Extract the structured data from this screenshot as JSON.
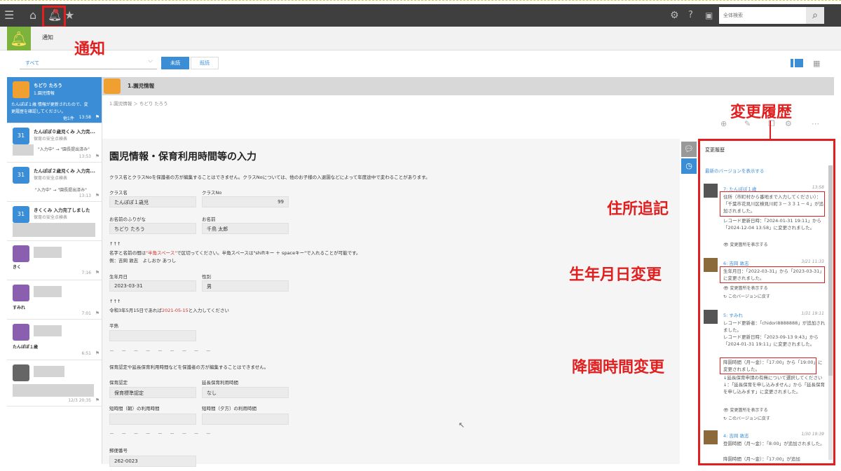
{
  "search": {
    "placeholder": "全体検索"
  },
  "header": {
    "title": "通知"
  },
  "filter": {
    "selected": "すべて",
    "tab_unread": "未読",
    "tab_read": "既読"
  },
  "left_list": [
    {
      "title": "ちどり たろう",
      "sub": "1.園児情報",
      "line1": "たんぽぽ１歳 情報が更新されたので、変",
      "line2": "更履歴を確認してください。",
      "count": "他1件",
      "time": "13:58"
    },
    {
      "title": "たんぽぽ０歳児くみ 入力完...",
      "sub": "保育の安全点検表",
      "line1": "\"入力中\" → \"園長提出済み\"",
      "time": "13:53"
    },
    {
      "title": "たんぽぽ２歳児くみ 入力完...",
      "sub": "保育の安全点検表",
      "line1": "\"入力中\" → \"園長提出済み\"",
      "time": "13:13"
    },
    {
      "title": "きくくみ 入力完了しました",
      "sub": "保育の安全点検表"
    },
    {
      "label": "きく",
      "time": "7:16"
    },
    {
      "label": "すみれ",
      "time": "7:01"
    },
    {
      "label": "たんぽぽ１歳",
      "time": "6:51"
    },
    {
      "time": "12/3 20:35"
    }
  ],
  "main": {
    "title": "1.園児情報",
    "breadcrumb": "1.園児情報 ＞ ちどり たろう",
    "form_title": "園児情報・保育利用時間等の入力",
    "desc": "クラス名とクラスNoを保護者の方が編集することはできません。クラスNoについては、他のお子様の入退園などによって年度途中で変わることがあります。",
    "class_name_label": "クラス名",
    "class_name": "たんぽぽ１歳児",
    "class_no_label": "クラスNo",
    "class_no": "99",
    "kana_label": "お名前のふりがな",
    "kana": "ちどり たろう",
    "name_label": "お名前",
    "name": "千鳥 太郎",
    "arrows1": "↑↑↑",
    "note1_a": "名字と名前の間は",
    "note1_red": "\"半角スペース\"",
    "note1_b": "で区切ってください。半角スペースは\"shiftキー ＋ spaceキー\"で入れることが可能です。",
    "note1_ex": "例：吉岡 敦志　よしおか あつし",
    "birth_label": "生年月日",
    "birth": "2023-03-31",
    "sex_label": "性別",
    "sex": "男",
    "arrows2": "↑↑↑",
    "note2_a": "令和3年5月15日であれば",
    "note2_red": "2021-05-15",
    "note2_b": "と入力してください",
    "heat_label": "平熱",
    "dashes": "－ － － － － － － － －",
    "desc2": "保育認定や延長保育利用時間などを保護者の方が編集することはできません。",
    "cert_label": "保育認定",
    "cert": "保育標準認定",
    "ext_label": "延長保育利用時間",
    "ext": "なし",
    "short_am_label": "短時間（朝）の利用時間",
    "short_pm_label": "短時間（夕方）の利用時間",
    "zip_label": "郵便番号",
    "zip": "262-0023"
  },
  "history": {
    "title": "変更履歴",
    "latest_link": "最新のバージョンを表示する",
    "entries": [
      {
        "head": "7: たんぽぽ１歳",
        "time": "13:58",
        "t1": "住所（市町村から番地まで入力してください）：「千葉市花見川区検見川町３－３３１－４」が追加されました。",
        "t2": "レコード更新日時：「2024-01-31 19:11」から「2024-12-04 13:58」に変更されました。",
        "a1": "変更箇所を表示する"
      },
      {
        "head": "6: 吉岡 敦志",
        "time": "3/21 11:33",
        "t1": "生年月日：「2022-03-31」から「2023-03-31」に変更されました。",
        "a1": "変更箇所を表示する",
        "a2": "このバージョンに戻す"
      },
      {
        "head": "5: すみれ",
        "time": "1/31 19:11",
        "t1": "レコード更新者：「chidori8888888」が追加されました。",
        "t2": "レコード更新日時：「2023-09-13 9:43」から「2024-01-31 19:11」に変更されました。",
        "t3": "降園時間（月～金）：「17:00」から「19:00」に変更されました。",
        "t4": "↓延長保育申請の有無について選択してください↓：「延長保育を申し込みません」から「延長保育を申し込みます」に変更されました。",
        "a1": "変更箇所を表示する",
        "a2": "このバージョンに戻す"
      },
      {
        "head": "4: 吉岡 敦志",
        "time": "1/30 19:39",
        "t1": "登園時間（月～金）：「8:00」が追加されました。",
        "t2": "降園時間（月～金）：「17:00」が追加"
      }
    ]
  },
  "annotations": {
    "bell": "通知",
    "history": "変更履歴",
    "address": "住所追記",
    "birth": "生年月日変更",
    "pickup": "降園時間変更"
  },
  "colors": {
    "accent": "#3b8ed6",
    "annotation": "#e02020",
    "bell_bg": "#7bb33c",
    "topbar": "#3f3f3f"
  }
}
